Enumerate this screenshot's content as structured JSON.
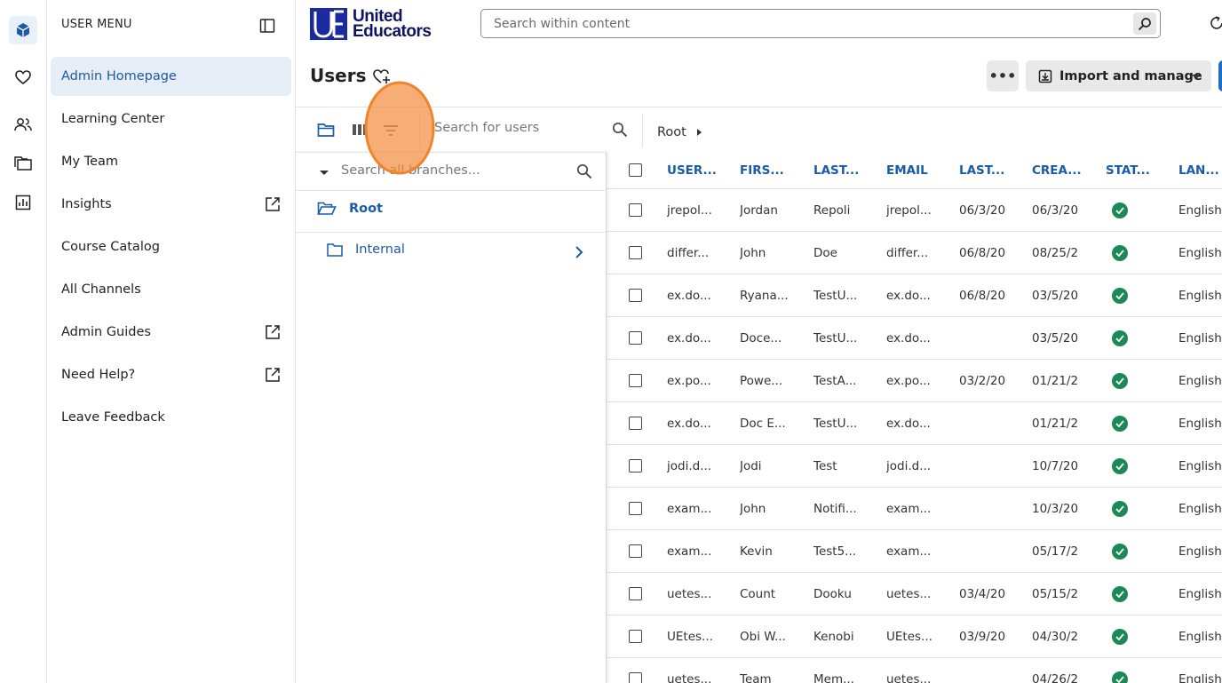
{
  "rail": {
    "items": [
      {
        "icon": "cube-icon",
        "active": true
      },
      {
        "icon": "heart-icon",
        "active": false
      },
      {
        "icon": "people-icon",
        "active": false
      },
      {
        "icon": "folders-icon",
        "active": false
      },
      {
        "icon": "chart-icon",
        "active": false
      }
    ]
  },
  "sidebar": {
    "header": "USER MENU",
    "items": [
      {
        "label": "Admin Homepage",
        "active": true,
        "external": false
      },
      {
        "label": "Learning Center",
        "active": false,
        "external": false
      },
      {
        "label": "My Team",
        "active": false,
        "external": false
      },
      {
        "label": "Insights",
        "active": false,
        "external": true
      },
      {
        "label": "Course Catalog",
        "active": false,
        "external": false
      },
      {
        "label": "All Channels",
        "active": false,
        "external": false
      },
      {
        "label": "Admin Guides",
        "active": false,
        "external": true
      },
      {
        "label": "Need Help?",
        "active": false,
        "external": true
      },
      {
        "label": "Leave Feedback",
        "active": false,
        "external": false
      }
    ]
  },
  "header": {
    "logo_line1": "United",
    "logo_line2": "Educators",
    "search_placeholder": "Search within content"
  },
  "page": {
    "title": "Users",
    "more_label": "•••",
    "import_label": "Import and manage"
  },
  "toolbar": {
    "search_placeholder": "Search for users",
    "breadcrumb": "Root"
  },
  "branches": {
    "search_placeholder": "Search all branches...",
    "root_label": "Root",
    "child_label": "Internal"
  },
  "table": {
    "columns": [
      "USER...",
      "FIRS...",
      "LAST...",
      "EMAIL",
      "LAST...",
      "CREA...",
      "STAT...",
      "LAN..."
    ],
    "rows": [
      [
        "jrepol...",
        "Jordan",
        "Repoli",
        "jrepol...",
        "06/3/20",
        "06/3/20",
        "active",
        "English"
      ],
      [
        "differ...",
        "John",
        "Doe",
        "differ...",
        "06/8/20",
        "08/25/2",
        "active",
        "English"
      ],
      [
        "ex.do...",
        "Ryana...",
        "TestU...",
        "ex.do...",
        "06/8/20",
        "03/5/20",
        "active",
        "English"
      ],
      [
        "ex.do...",
        "Doce...",
        "TestU...",
        "ex.do...",
        "",
        "03/5/20",
        "active",
        "English"
      ],
      [
        "ex.po...",
        "Powe...",
        "TestA...",
        "ex.po...",
        "03/2/20",
        "01/21/2",
        "active",
        "English"
      ],
      [
        "ex.do...",
        "Doc E...",
        "TestU...",
        "ex.do...",
        "",
        "01/21/2",
        "active",
        "English"
      ],
      [
        "jodi.d...",
        "Jodi",
        "Test",
        "jodi.d...",
        "",
        "10/7/20",
        "active",
        "English"
      ],
      [
        "exam...",
        "John",
        "Notifi...",
        "exam...",
        "",
        "10/3/20",
        "active",
        "English"
      ],
      [
        "exam...",
        "Kevin",
        "Test5...",
        "exam...",
        "",
        "05/17/2",
        "active",
        "English"
      ],
      [
        "uetes...",
        "Count",
        "Dooku",
        "uetes...",
        "03/4/20",
        "05/15/2",
        "active",
        "English"
      ],
      [
        "UEtes...",
        "Obi W...",
        "Kenobi",
        "UEtes...",
        "03/9/20",
        "04/30/2",
        "active",
        "English"
      ],
      [
        "uetes...",
        "Team",
        "Mem...",
        "uetes...",
        "",
        "04/26/2",
        "active",
        "English"
      ]
    ]
  },
  "colors": {
    "accent": "#1a5ba8",
    "status_active": "#1c8a55",
    "highlight": "#f08427"
  }
}
